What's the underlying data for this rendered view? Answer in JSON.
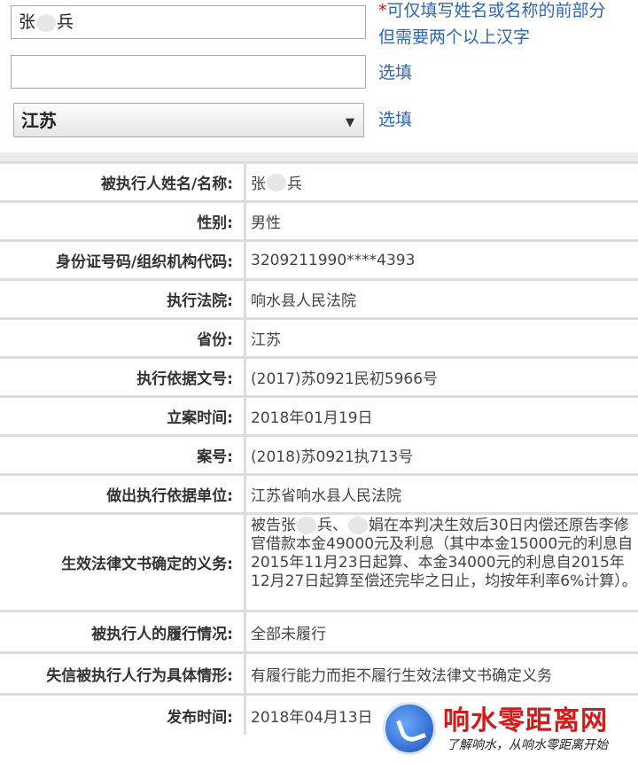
{
  "form": {
    "name_value_prefix": "张",
    "name_value_suffix": "兵",
    "name_hint_line1": "可仅填写姓名或名称的前部分",
    "name_hint_line2": "但需要两个以上汉字",
    "required_mark": "*",
    "id_value": "",
    "optional_label_1": "选填",
    "province_selected": "江苏",
    "optional_label_2": "选填"
  },
  "rows": [
    {
      "label": "被执行人姓名/名称:",
      "value_prefix": "张",
      "value_suffix": "兵"
    },
    {
      "label": "性别:",
      "value": "男性"
    },
    {
      "label": "身份证号码/组织机构代码:",
      "value": "3209211990****4393"
    },
    {
      "label": "执行法院:",
      "value": "响水县人民法院"
    },
    {
      "label": "省份:",
      "value": "江苏"
    },
    {
      "label": "执行依据文号:",
      "value": "(2017)苏0921民初5966号"
    },
    {
      "label": "立案时间:",
      "value": "2018年01月19日"
    },
    {
      "label": "案号:",
      "value": "(2018)苏0921执713号"
    },
    {
      "label": "做出执行依据单位:",
      "value": "江苏省响水县人民法院"
    },
    {
      "label": "生效法律文书确定的义务:",
      "value_prefix": "被告张",
      "value_mid": "兵、",
      "value_suffix": "娟在本判决生效后30日内偿还原告李修官借款本金49000元及利息（其中本金15000元的利息自2015年11月23日起算、本金34000元的利息自2015年12月27日起算至偿还完毕之日止，均按年利率6%计算）。"
    },
    {
      "label": "被执行人的履行情况:",
      "value": "全部未履行"
    },
    {
      "label": "失信被执行人行为具体情形:",
      "value": "有履行能力而拒不履行生效法律文书确定义务"
    },
    {
      "label": "发布时间:",
      "value": "2018年04月13日"
    }
  ],
  "watermark": {
    "title": "响水零距离网",
    "subtitle": "了解响水，从响水零距离开始"
  },
  "colors": {
    "hint_blue": "#2e66b8",
    "required_red": "#e00000",
    "watermark_red": "#d21c1c",
    "border_gray": "#dddddd"
  }
}
